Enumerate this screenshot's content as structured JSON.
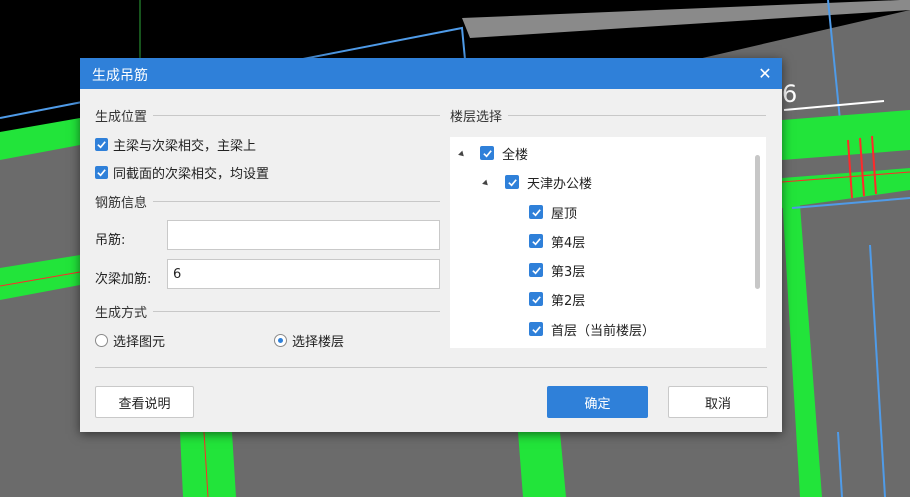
{
  "background": {
    "dimension_label": "6"
  },
  "dialog": {
    "title": "生成吊筋",
    "close_glyph": "✕",
    "position_section": {
      "title": "生成位置",
      "options": [
        {
          "label": "主梁与次梁相交，主梁上",
          "checked": true
        },
        {
          "label": "同截面的次梁相交，均设置",
          "checked": true
        }
      ]
    },
    "rebar_section": {
      "title": "钢筋信息",
      "hanger_label": "吊筋:",
      "hanger_value": "",
      "secondary_label": "次梁加筋:",
      "secondary_value": "6"
    },
    "method_section": {
      "title": "生成方式",
      "options": [
        {
          "label": "选择图元",
          "selected": false
        },
        {
          "label": "选择楼层",
          "selected": true
        }
      ]
    },
    "floor_section": {
      "title": "楼层选择",
      "tree": [
        {
          "label": "全楼",
          "level": 0,
          "expanded": true,
          "checked": true
        },
        {
          "label": "天津办公楼",
          "level": 1,
          "expanded": true,
          "checked": true
        },
        {
          "label": "屋顶",
          "level": 2,
          "checked": true
        },
        {
          "label": "第4层",
          "level": 2,
          "checked": true
        },
        {
          "label": "第3层",
          "level": 2,
          "checked": true
        },
        {
          "label": "第2层",
          "level": 2,
          "checked": true
        },
        {
          "label": "首层（当前楼层）",
          "level": 2,
          "checked": true
        }
      ]
    },
    "buttons": {
      "help": "查看说明",
      "ok": "确定",
      "cancel": "取消"
    }
  },
  "colors": {
    "accent": "#2f80d9",
    "cad_green": "#22e43a",
    "cad_gray": "#6b6b6b"
  }
}
